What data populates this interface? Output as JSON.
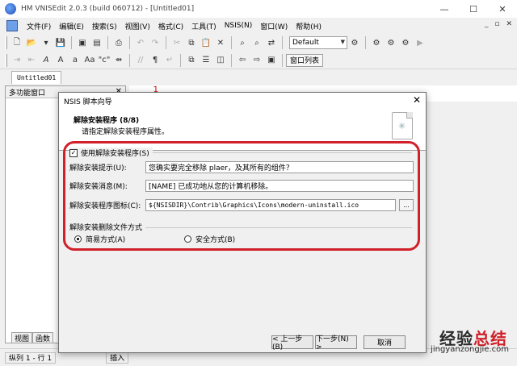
{
  "window": {
    "title": "HM VNISEdit 2.0.3 (build 060712) - [Untitled01]",
    "minimize": "—",
    "maximize": "☐",
    "close": "✕"
  },
  "menu": {
    "items": [
      "文件(F)",
      "编辑(E)",
      "搜索(S)",
      "视图(V)",
      "格式(C)",
      "工具(T)",
      "NSIS(N)",
      "窗口(W)",
      "帮助(H)"
    ],
    "mdi_min": "_",
    "mdi_restore": "▫",
    "mdi_close": "✕"
  },
  "toolbar": {
    "config_combo": "Default",
    "window_list_button": "窗口列表"
  },
  "tabs": {
    "document": "Untitled01"
  },
  "left_panel": {
    "title": "多功能窗口",
    "tabs": [
      "视图",
      "函数"
    ]
  },
  "editor": {
    "line_number": "1"
  },
  "statusbar": {
    "position": "纵列 1 - 行 1",
    "mode": "插入"
  },
  "dialog": {
    "title": "NSIS 脚本向导",
    "close": "✕",
    "header_title": "解除安装程序 (8/8)",
    "header_subtitle": "请指定解除安装程序属性。",
    "use_uninstaller_label": "使用解除安装程序(S)",
    "use_uninstaller_checked": true,
    "prompt_label": "解除安装提示(U):",
    "prompt_value": "您确实要完全移除 plaer，及其所有的组件？",
    "message_label": "解除安装消息(M):",
    "message_value": "[NAME] 已成功地从您的计算机移除。",
    "icon_label": "解除安装程序图标(C):",
    "icon_value": "${NSISDIR}\\Contrib\\Graphics\\Icons\\modern-uninstall.ico",
    "browse_button": "...",
    "delete_mode_label": "解除安装删除文件方式",
    "simple_mode": "简易方式(A)",
    "safe_mode": "安全方式(B)",
    "selected_mode": "simple",
    "back_button": "< 上一步(B)",
    "next_button": "下一步(N) >",
    "cancel_button": "取消"
  },
  "watermark": {
    "brand_part1": "经验",
    "brand_part2": "总结",
    "url": "jingyanzongjie.com"
  },
  "colors": {
    "highlight": "#d0202a",
    "window_bg": "#f0f0f0"
  }
}
